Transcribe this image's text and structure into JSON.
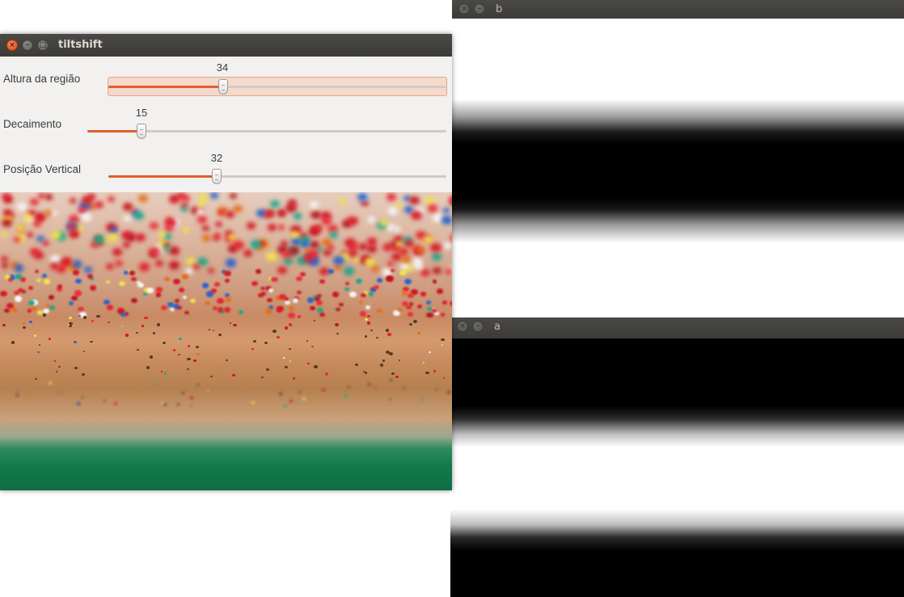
{
  "windows": {
    "tiltshift": {
      "title": "tiltshift",
      "close_glyph": "×",
      "minimize_glyph": "–",
      "maximize_glyph": "□",
      "trackbars": [
        {
          "label": "Altura da região",
          "value": "34",
          "fraction": 0.34
        },
        {
          "label": "Decaimento",
          "value": "15",
          "fraction": 0.15
        },
        {
          "label": "Posição Vertical",
          "value": "32",
          "fraction": 0.32
        }
      ]
    },
    "b": {
      "title": "b",
      "close_glyph": "×",
      "minimize_glyph": "–"
    },
    "a": {
      "title": "a",
      "close_glyph": "×",
      "minimize_glyph": "–"
    }
  },
  "colors": {
    "accent": "#e05e2c",
    "titlebar": "#3c3b37",
    "window_bg": "#f2f1f0"
  },
  "icons": [
    "close-icon",
    "minimize-icon",
    "maximize-icon"
  ]
}
